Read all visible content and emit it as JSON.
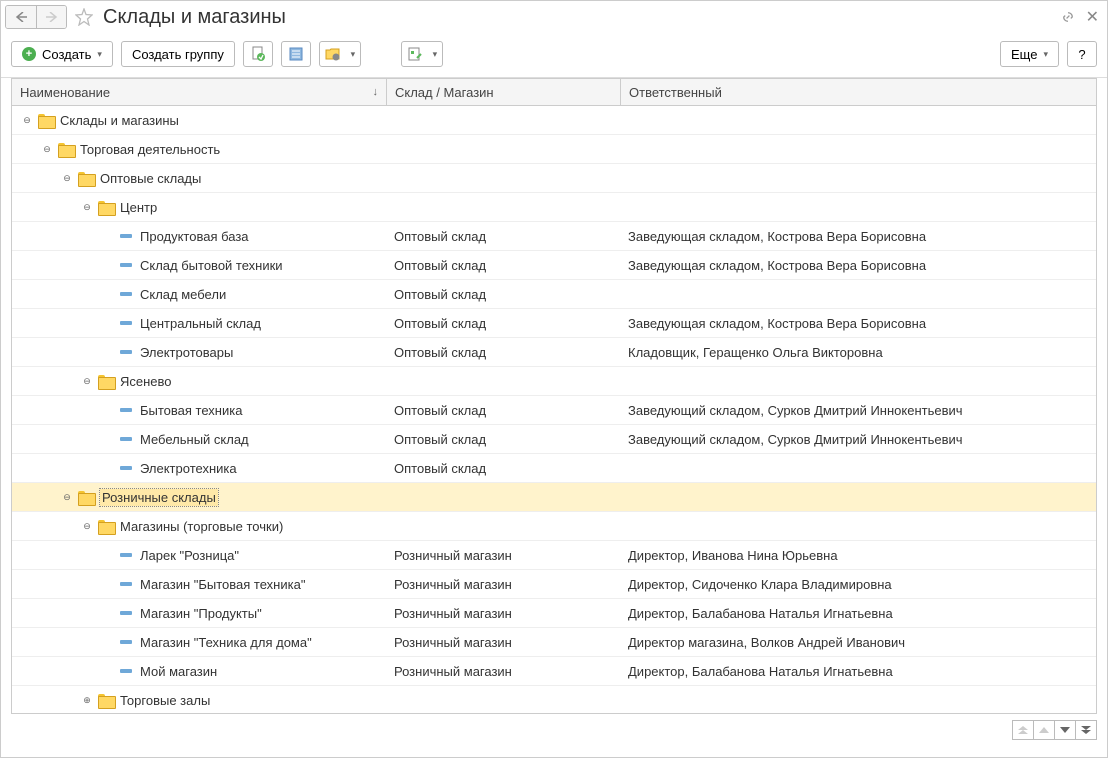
{
  "title": "Склады и магазины",
  "toolbar": {
    "create": "Создать",
    "create_group": "Создать группу",
    "more": "Еще",
    "help": "?"
  },
  "columns": {
    "name": "Наименование",
    "type": "Склад / Магазин",
    "responsible": "Ответственный"
  },
  "rows": [
    {
      "level": 0,
      "kind": "folder",
      "toggle": "minus",
      "name": "Склады и магазины",
      "type": "",
      "resp": ""
    },
    {
      "level": 1,
      "kind": "folder",
      "toggle": "minus",
      "name": "Торговая деятельность",
      "type": "",
      "resp": ""
    },
    {
      "level": 2,
      "kind": "folder",
      "toggle": "minus",
      "name": "Оптовые склады",
      "type": "",
      "resp": ""
    },
    {
      "level": 3,
      "kind": "folder",
      "toggle": "minus",
      "name": "Центр",
      "type": "",
      "resp": ""
    },
    {
      "level": 4,
      "kind": "item",
      "toggle": "",
      "name": "Продуктовая база",
      "type": "Оптовый склад",
      "resp": "Заведующая складом, Кострова Вера Борисовна"
    },
    {
      "level": 4,
      "kind": "item",
      "toggle": "",
      "name": "Склад бытовой техники",
      "type": "Оптовый склад",
      "resp": "Заведующая складом, Кострова Вера Борисовна"
    },
    {
      "level": 4,
      "kind": "item",
      "toggle": "",
      "name": "Склад мебели",
      "type": "Оптовый склад",
      "resp": ""
    },
    {
      "level": 4,
      "kind": "item",
      "toggle": "",
      "name": "Центральный склад",
      "type": "Оптовый склад",
      "resp": "Заведующая складом, Кострова Вера Борисовна"
    },
    {
      "level": 4,
      "kind": "item",
      "toggle": "",
      "name": "Электротовары",
      "type": "Оптовый склад",
      "resp": "Кладовщик, Геращенко Ольга Викторовна"
    },
    {
      "level": 3,
      "kind": "folder",
      "toggle": "minus",
      "name": "Ясенево",
      "type": "",
      "resp": ""
    },
    {
      "level": 4,
      "kind": "item",
      "toggle": "",
      "name": "Бытовая техника",
      "type": "Оптовый склад",
      "resp": "Заведующий складом, Сурков Дмитрий Иннокентьевич"
    },
    {
      "level": 4,
      "kind": "item",
      "toggle": "",
      "name": "Мебельный склад",
      "type": "Оптовый склад",
      "resp": "Заведующий складом, Сурков Дмитрий Иннокентьевич"
    },
    {
      "level": 4,
      "kind": "item",
      "toggle": "",
      "name": "Электротехника",
      "type": "Оптовый склад",
      "resp": ""
    },
    {
      "level": 2,
      "kind": "folder",
      "toggle": "minus",
      "name": "Розничные склады",
      "type": "",
      "resp": "",
      "selected": true
    },
    {
      "level": 3,
      "kind": "folder",
      "toggle": "minus",
      "name": "Магазины (торговые точки)",
      "type": "",
      "resp": ""
    },
    {
      "level": 4,
      "kind": "item",
      "toggle": "",
      "name": "Ларек \"Розница\"",
      "type": "Розничный магазин",
      "resp": "Директор, Иванова Нина Юрьевна"
    },
    {
      "level": 4,
      "kind": "item",
      "toggle": "",
      "name": "Магазин \"Бытовая техника\"",
      "type": "Розничный магазин",
      "resp": "Директор, Сидоченко Клара Владимировна"
    },
    {
      "level": 4,
      "kind": "item",
      "toggle": "",
      "name": "Магазин \"Продукты\"",
      "type": "Розничный магазин",
      "resp": "Директор, Балабанова Наталья Игнатьевна"
    },
    {
      "level": 4,
      "kind": "item",
      "toggle": "",
      "name": "Магазин \"Техника для дома\"",
      "type": "Розничный магазин",
      "resp": "Директор магазина, Волков Андрей Иванович"
    },
    {
      "level": 4,
      "kind": "item",
      "toggle": "",
      "name": "Мой магазин",
      "type": "Розничный магазин",
      "resp": "Директор, Балабанова Наталья Игнатьевна"
    },
    {
      "level": 3,
      "kind": "folder",
      "toggle": "plus",
      "name": "Торговые залы",
      "type": "",
      "resp": ""
    }
  ]
}
